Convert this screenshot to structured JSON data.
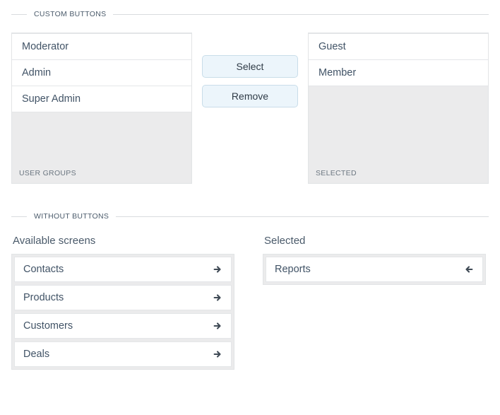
{
  "section1": {
    "legend": "CUSTOM BUTTONS",
    "left_label": "USER GROUPS",
    "right_label": "SELECTED",
    "buttons": {
      "select": "Select",
      "remove": "Remove"
    },
    "left_items": [
      "Moderator",
      "Admin",
      "Super Admin"
    ],
    "right_items": [
      "Guest",
      "Member"
    ]
  },
  "section2": {
    "legend": "WITHOUT BUTTONS",
    "left_header": "Available screens",
    "right_header": "Selected",
    "left_items": [
      "Contacts",
      "Products",
      "Customers",
      "Deals"
    ],
    "right_items": [
      "Reports"
    ]
  }
}
